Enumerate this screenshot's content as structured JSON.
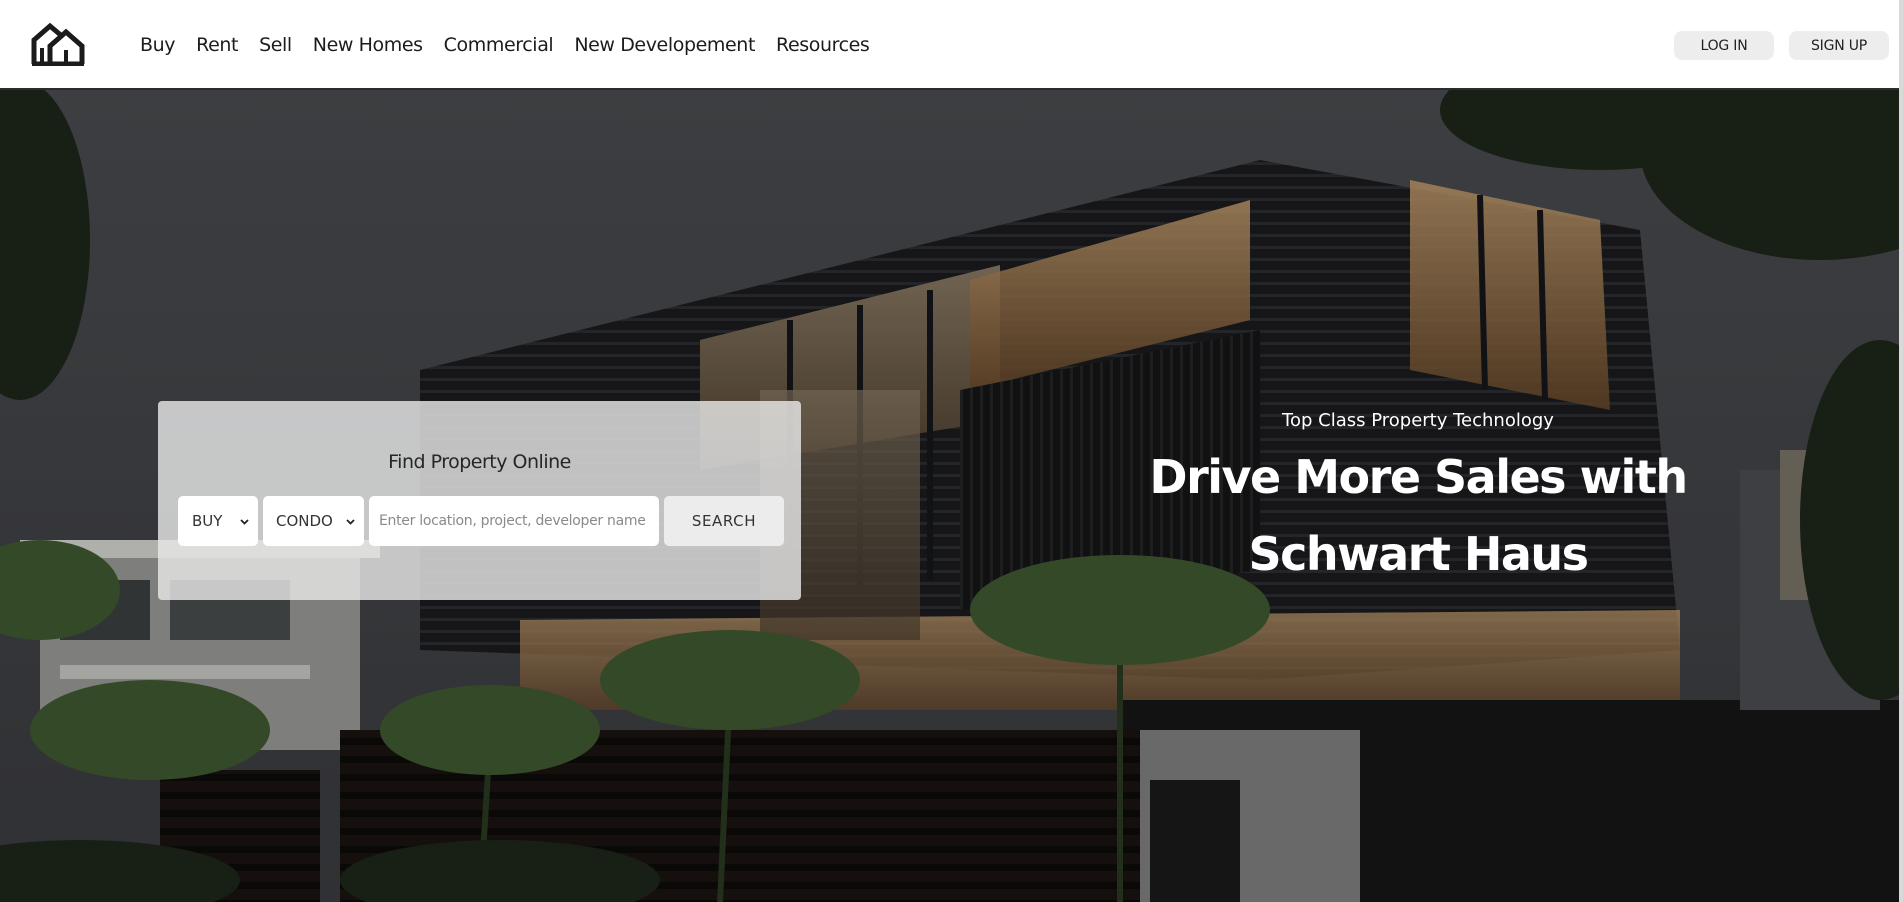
{
  "header": {
    "logo_icon": "house-logo-icon",
    "nav": [
      "Buy",
      "Rent",
      "Sell",
      "New Homes",
      "Commercial",
      "New Developement",
      "Resources"
    ],
    "login_label": "LOG IN",
    "signup_label": "SIGN UP"
  },
  "search": {
    "title": "Find Property Online",
    "listing_type": "BUY",
    "property_type": "CONDO",
    "placeholder": "Enter location, project, developer name",
    "button_label": "SEARCH"
  },
  "hero": {
    "kicker": "Top Class Property Technology",
    "title_line1": "Drive More Sales with",
    "title_line2": "Schwart Haus"
  },
  "colors": {
    "header_bg": "#ffffff",
    "text_dark": "#1c1c1c",
    "button_bg": "#ededed",
    "hero_text": "#ffffff"
  }
}
